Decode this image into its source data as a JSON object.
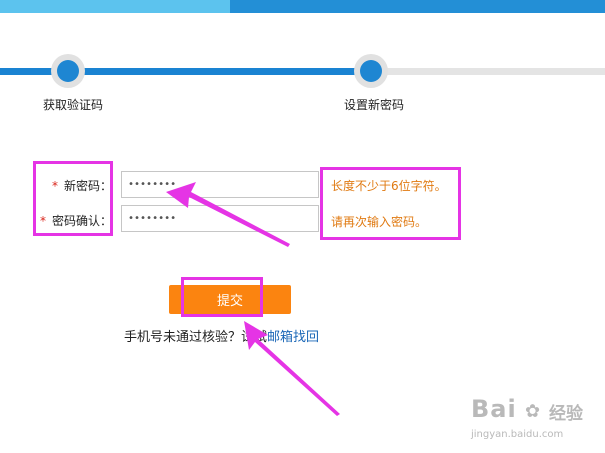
{
  "colors": {
    "topbar_left": "#5cc3ee",
    "topbar_right": "#238fd6",
    "progress_done": "#1a83d2",
    "progress_todo": "#e4e4e4",
    "accent_button": "#fb8410",
    "hint_text": "#e07a12",
    "required_mark": "#d9251b",
    "link": "#1a67b7",
    "annotation": "#e534e5"
  },
  "steps": [
    {
      "label": "获取验证码",
      "state": "done"
    },
    {
      "label": "设置新密码",
      "state": "current"
    }
  ],
  "form": {
    "required_mark": "*",
    "new_password": {
      "label": "新密码：",
      "value": "••••••••",
      "hint": "长度不少于6位字符。"
    },
    "confirm_password": {
      "label": "密码确认：",
      "value": "••••••••",
      "hint": "请再次输入密码。"
    },
    "submit_label": "提交"
  },
  "alternate": {
    "text": "手机号未通过核验？试试",
    "link": "邮箱找回"
  },
  "watermark": {
    "brand": "Bai",
    "brand_cn": "经验",
    "url": "jingyan.baidu.com"
  }
}
